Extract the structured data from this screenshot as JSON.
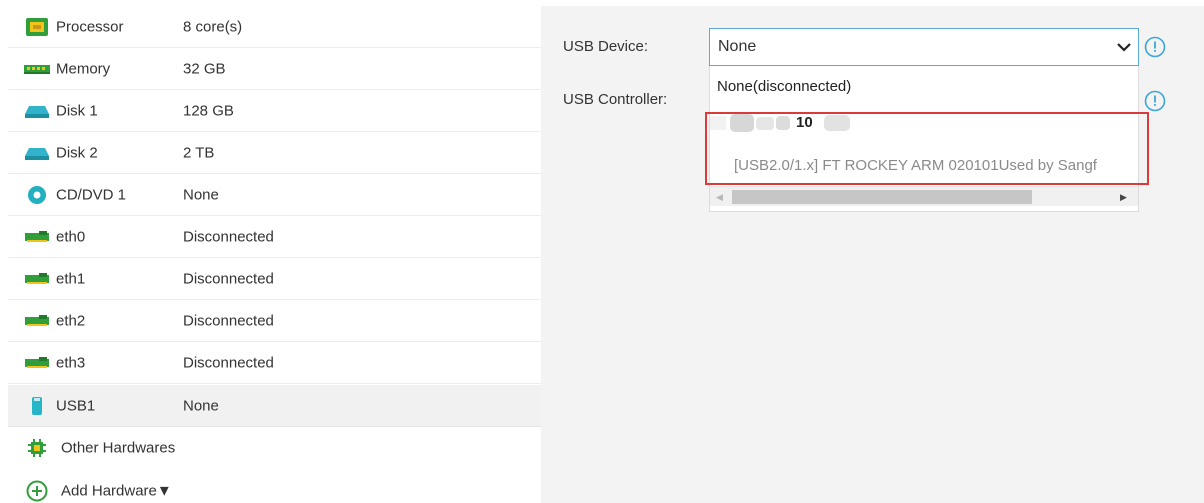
{
  "hardware": {
    "items": [
      {
        "label": "Processor",
        "value": "8 core(s)",
        "icon": "processor-icon"
      },
      {
        "label": "Memory",
        "value": "32 GB",
        "icon": "memory-icon"
      },
      {
        "label": "Disk 1",
        "value": "128 GB",
        "icon": "disk-icon"
      },
      {
        "label": "Disk 2",
        "value": "2 TB",
        "icon": "disk-icon"
      },
      {
        "label": "CD/DVD 1",
        "value": "None",
        "icon": "cd-dvd-icon"
      },
      {
        "label": "eth0",
        "value": "Disconnected",
        "icon": "network-card-icon"
      },
      {
        "label": "eth1",
        "value": "Disconnected",
        "icon": "network-card-icon"
      },
      {
        "label": "eth2",
        "value": "Disconnected",
        "icon": "network-card-icon"
      },
      {
        "label": "eth3",
        "value": "Disconnected",
        "icon": "network-card-icon"
      },
      {
        "label": "USB1",
        "value": "None",
        "icon": "usb-icon",
        "selected": true
      }
    ],
    "other_label": "Other Hardwares",
    "add_label": "Add Hardware▼"
  },
  "usb_panel": {
    "device_label": "USB Device:",
    "controller_label": "USB Controller:",
    "selected_value": "None",
    "options": [
      "None(disconnected)",
      "[USB2.0/1.x] FT ROCKEY ARM 020101Used by Sangf"
    ],
    "partial_option_text": "10"
  },
  "colors": {
    "accent": "#5aa9d6",
    "highlight": "#d93a3a",
    "icon_green": "#2f9e3b",
    "panel_bg": "#f3f3f3"
  }
}
